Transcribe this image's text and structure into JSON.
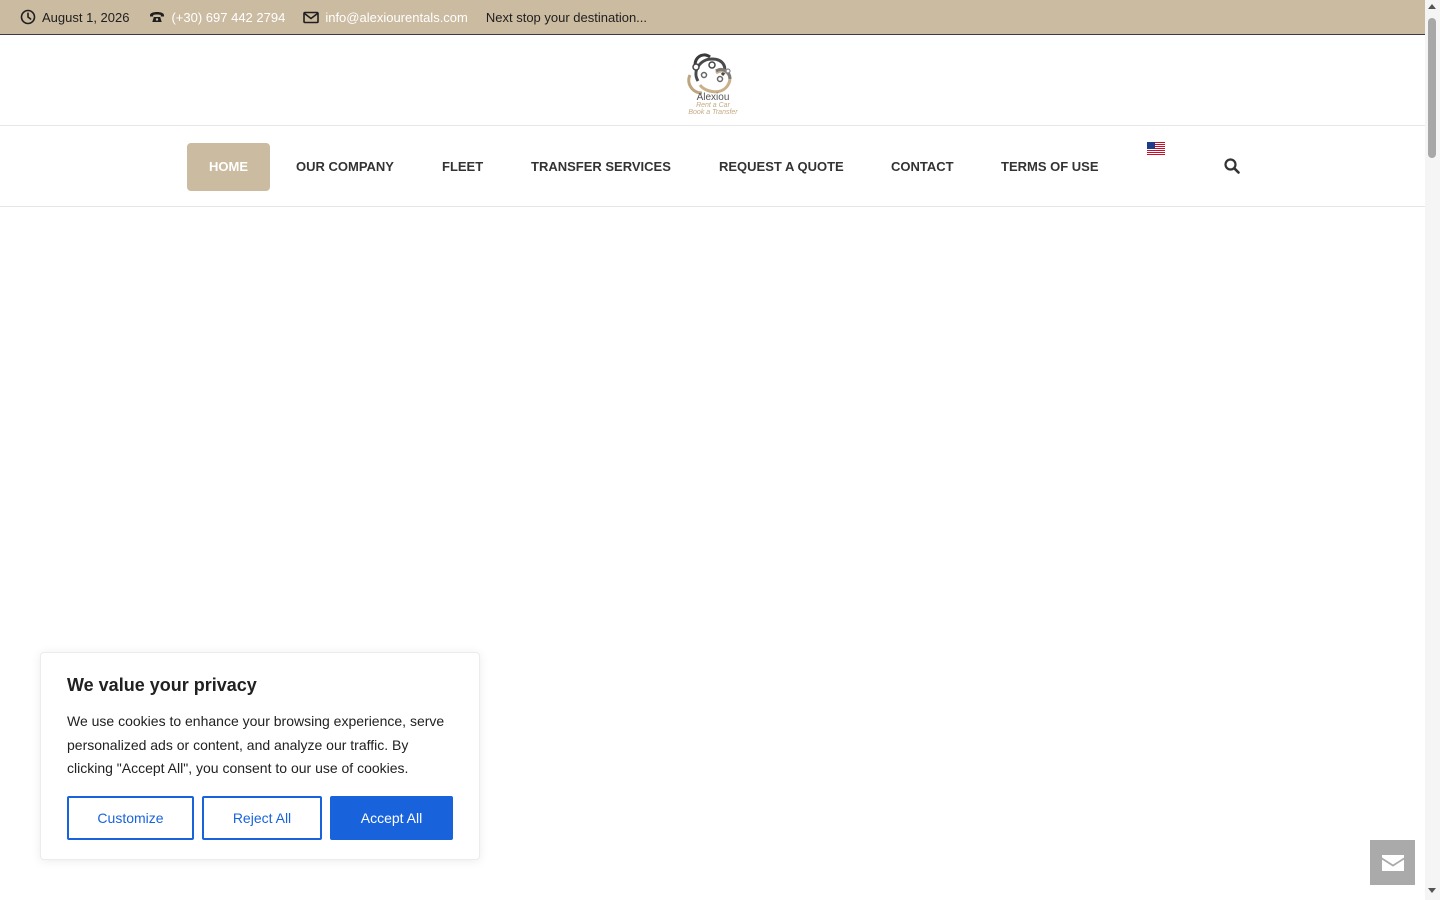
{
  "topbar": {
    "date": "August 1, 2026",
    "phone": "(+30) 697 442 2794",
    "email": "info@alexiourentals.com",
    "tagline": "Next stop your destination...",
    "icons": [
      "clock-icon",
      "phone-icon",
      "envelope-icon"
    ]
  },
  "logo": {
    "name": "Alexiou",
    "line1": "Rent a Car",
    "line2": "Book a Transfer"
  },
  "nav": {
    "items": [
      {
        "label": "HOME",
        "active": true
      },
      {
        "label": "OUR COMPANY"
      },
      {
        "label": "FLEET"
      },
      {
        "label": "TRANSFER SERVICES"
      },
      {
        "label": "REQUEST A QUOTE"
      },
      {
        "label": "CONTACT"
      },
      {
        "label": "TERMS OF USE"
      }
    ],
    "language_icon": "us-flag-icon",
    "search_icon": "search-icon"
  },
  "cookie": {
    "title": "We value your privacy",
    "text": "We use cookies to enhance your browsing experience, serve personalized ads or content, and analyze our traffic. By clicking \"Accept All\", you consent to our use of cookies.",
    "customize": "Customize",
    "reject": "Reject All",
    "accept": "Accept All"
  },
  "colors": {
    "accent": "#cbbba0",
    "button_blue": "#1863dc",
    "float_button": "#aaaaaa"
  }
}
